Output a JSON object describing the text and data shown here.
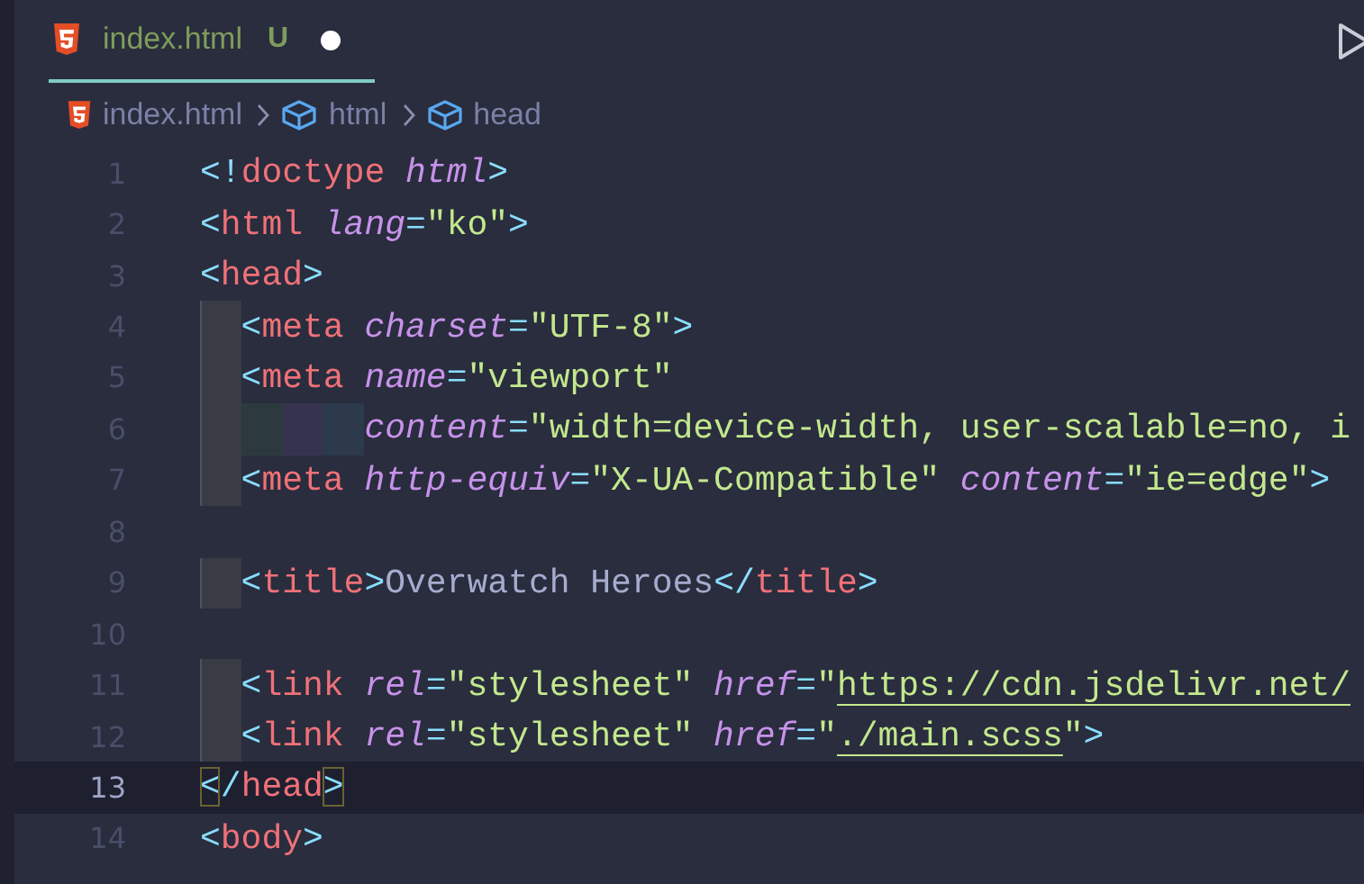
{
  "tab": {
    "filename": "index.html",
    "git_status": "U",
    "modified": true,
    "selected": true
  },
  "breadcrumb": [
    {
      "kind": "file",
      "label": "index.html"
    },
    {
      "kind": "symbol",
      "label": "html"
    },
    {
      "kind": "symbol",
      "label": "head"
    }
  ],
  "lines": [
    {
      "number": "1",
      "selected": false,
      "tokens": [
        {
          "kind": "punct",
          "text": "<!"
        },
        {
          "kind": "tag",
          "text": "doctype"
        },
        {
          "kind": "attr",
          "text": "html"
        },
        {
          "kind": "punct",
          "text": ">"
        }
      ]
    },
    {
      "number": "2",
      "selected": false,
      "tokens": [
        {
          "kind": "punct",
          "text": "<"
        },
        {
          "kind": "tag",
          "text": "html"
        },
        {
          "kind": "attr",
          "text": "lang"
        },
        {
          "kind": "punct",
          "text": "="
        },
        {
          "kind": "string",
          "text": "\"ko\""
        },
        {
          "kind": "punct",
          "text": ">"
        }
      ]
    },
    {
      "number": "3",
      "selected": false,
      "tokens": [
        {
          "kind": "punct",
          "text": "<"
        },
        {
          "kind": "tag",
          "text": "head"
        },
        {
          "kind": "punct",
          "text": ">"
        }
      ]
    },
    {
      "number": "4",
      "selected": false,
      "indent": [
        {
          "color": "#393c44"
        }
      ],
      "tokens": [
        {
          "kind": "punct",
          "text": "<"
        },
        {
          "kind": "tag",
          "text": "meta"
        },
        {
          "kind": "attr",
          "text": "charset"
        },
        {
          "kind": "punct",
          "text": "="
        },
        {
          "kind": "string",
          "text": "\"UTF-8\""
        },
        {
          "kind": "punct",
          "text": ">"
        }
      ]
    },
    {
      "number": "5",
      "selected": false,
      "indent": [
        {
          "color": "#393c44"
        }
      ],
      "tokens": [
        {
          "kind": "punct",
          "text": "<"
        },
        {
          "kind": "tag",
          "text": "meta"
        },
        {
          "kind": "attr",
          "text": "name"
        },
        {
          "kind": "punct",
          "text": "="
        },
        {
          "kind": "string",
          "text": "\"viewport\""
        }
      ]
    },
    {
      "number": "6",
      "selected": false,
      "indent": [
        {
          "color": "#393c44"
        },
        {
          "color": "#2c3a3e"
        },
        {
          "color": "#36334f"
        },
        {
          "color": "#2c3a4b"
        }
      ],
      "tokens": [
        {
          "kind": "attr",
          "text": "content"
        },
        {
          "kind": "punct",
          "text": "="
        },
        {
          "kind": "string",
          "text": "\"width=device-width, user-scalable=no, i"
        }
      ]
    },
    {
      "number": "7",
      "selected": false,
      "indent": [
        {
          "color": "#393c44"
        }
      ],
      "tokens": [
        {
          "kind": "punct",
          "text": "<"
        },
        {
          "kind": "tag",
          "text": "meta"
        },
        {
          "kind": "attr",
          "text": "http-equiv"
        },
        {
          "kind": "punct",
          "text": "="
        },
        {
          "kind": "string",
          "text": "\"X-UA-Compatible\""
        },
        {
          "kind": "attr",
          "text": "content"
        },
        {
          "kind": "punct",
          "text": "="
        },
        {
          "kind": "string",
          "text": "\"ie=edge\""
        },
        {
          "kind": "punct",
          "text": ">"
        }
      ]
    },
    {
      "number": "8",
      "selected": false
    },
    {
      "number": "9",
      "selected": false,
      "indent": [
        {
          "color": "#393c44"
        }
      ],
      "tokens": [
        {
          "kind": "punct",
          "text": "<"
        },
        {
          "kind": "tag",
          "text": "title"
        },
        {
          "kind": "punct",
          "text": ">"
        },
        {
          "kind": "text",
          "text": "Overwatch Heroes"
        },
        {
          "kind": "punct",
          "text": "</"
        },
        {
          "kind": "tag",
          "text": "title"
        },
        {
          "kind": "punct",
          "text": ">"
        }
      ]
    },
    {
      "number": "10",
      "selected": false
    },
    {
      "number": "11",
      "selected": false,
      "indent": [
        {
          "color": "#393c44"
        }
      ],
      "tokens": [
        {
          "kind": "punct",
          "text": "<"
        },
        {
          "kind": "tag",
          "text": "link"
        },
        {
          "kind": "attr",
          "text": "rel"
        },
        {
          "kind": "punct",
          "text": "="
        },
        {
          "kind": "string",
          "text": "\"stylesheet\""
        },
        {
          "kind": "attr",
          "text": "href"
        },
        {
          "kind": "punct",
          "text": "="
        },
        {
          "kind": "string",
          "text": "\""
        },
        {
          "kind": "link",
          "text": "https://cdn.jsdelivr.net/"
        }
      ]
    },
    {
      "number": "12",
      "selected": false,
      "indent": [
        {
          "color": "#393c44"
        }
      ],
      "tokens": [
        {
          "kind": "punct",
          "text": "<"
        },
        {
          "kind": "tag",
          "text": "link"
        },
        {
          "kind": "attr",
          "text": "rel"
        },
        {
          "kind": "punct",
          "text": "="
        },
        {
          "kind": "string",
          "text": "\"stylesheet\""
        },
        {
          "kind": "attr",
          "text": "href"
        },
        {
          "kind": "punct",
          "text": "="
        },
        {
          "kind": "string",
          "text": "\""
        },
        {
          "kind": "link",
          "text": "./main.scss"
        },
        {
          "kind": "string",
          "text": "\""
        },
        {
          "kind": "punct",
          "text": ">"
        }
      ]
    },
    {
      "number": "13",
      "selected": true,
      "tokens": [
        {
          "kind": "bracket",
          "text": "<"
        },
        {
          "kind": "punct",
          "text": "/"
        },
        {
          "kind": "tag",
          "text": "head"
        },
        {
          "kind": "bracket",
          "text": ">"
        }
      ]
    },
    {
      "number": "14",
      "selected": false,
      "tokens": [
        {
          "kind": "punct",
          "text": "<"
        },
        {
          "kind": "tag",
          "text": "body"
        },
        {
          "kind": "punct",
          "text": ">"
        }
      ]
    }
  ]
}
